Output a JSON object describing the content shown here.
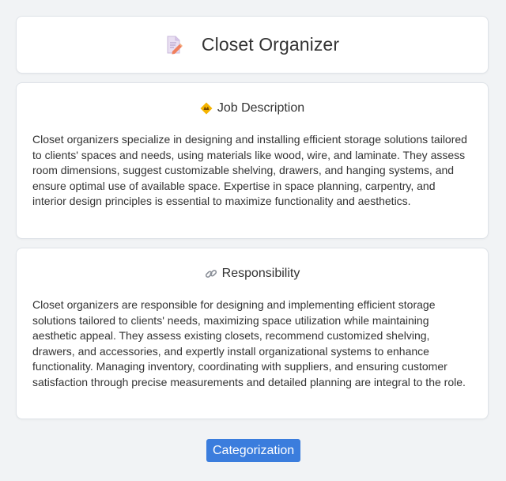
{
  "header": {
    "title": "Closet Organizer",
    "icon": "document-pencil-icon"
  },
  "job_description": {
    "heading": "Job Description",
    "icon": "diamond-warning-icon",
    "text": "Closet organizers specialize in designing and installing efficient storage solutions tailored to clients' spaces and needs, using materials like wood, wire, and laminate. They assess room dimensions, suggest customizable shelving, drawers, and hanging systems, and ensure optimal use of available space. Expertise in space planning, carpentry, and interior design principles is essential to maximize functionality and aesthetics."
  },
  "responsibility": {
    "heading": "Responsibility",
    "icon": "link-icon",
    "text": "Closet organizers are responsible for designing and implementing efficient storage solutions tailored to clients' needs, maximizing space utilization while maintaining aesthetic appeal. They assess existing closets, recommend customized shelving, drawers, and accessories, and expertly install organizational systems to enhance functionality. Managing inventory, coordinating with suppliers, and ensuring customer satisfaction through precise measurements and detailed planning are integral to the role."
  },
  "actions": {
    "categorization_label": "Categorization"
  },
  "colors": {
    "accent": "#3b7ddd",
    "background": "#f1f3f5",
    "card": "#ffffff"
  }
}
